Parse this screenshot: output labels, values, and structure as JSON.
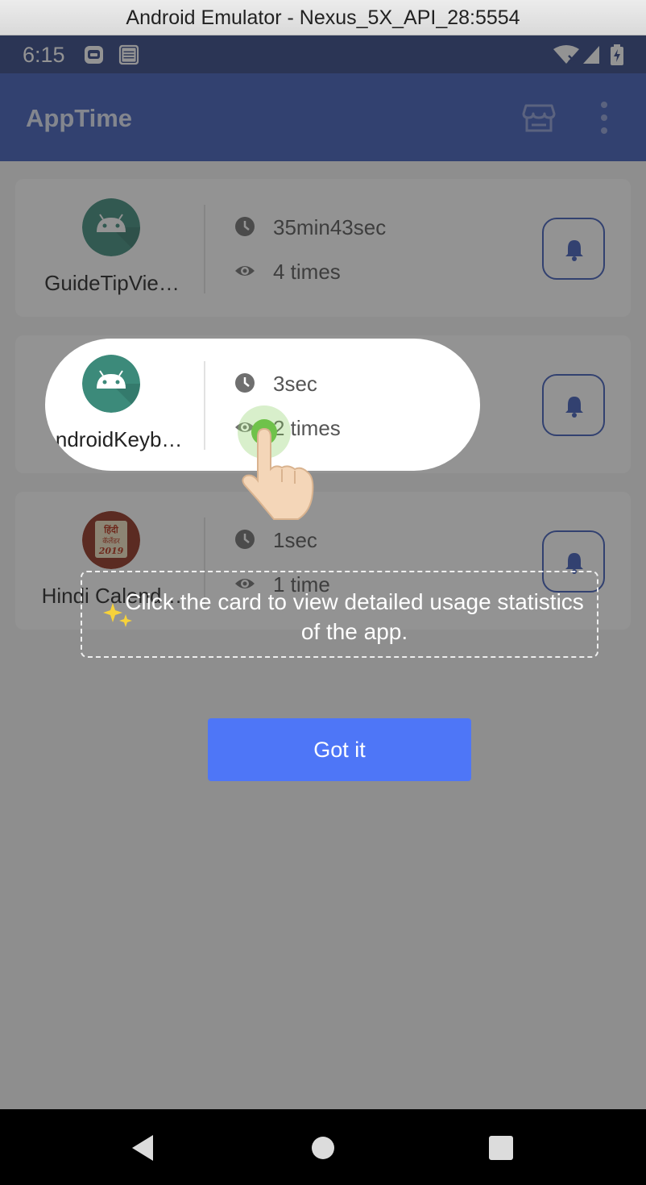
{
  "window": {
    "title": "Android Emulator - Nexus_5X_API_28:5554"
  },
  "status_bar": {
    "time": "6:15"
  },
  "app_bar": {
    "title": "AppTime",
    "store_icon": "store-icon",
    "more_icon": "more-vert-icon"
  },
  "apps": [
    {
      "name": "GuideTipVie…",
      "duration": "35min43sec",
      "opens": "4 times",
      "icon": "android-icon"
    },
    {
      "name": "AndroidKeyb…",
      "duration": "3sec",
      "opens": "2 times",
      "icon": "android-icon"
    },
    {
      "name": "Hindi Calend…",
      "duration": "1sec",
      "opens": "1 time",
      "icon": "calendar-2019-icon",
      "icon_text": [
        "हिंदी",
        "कॅलेंडर",
        "2019"
      ]
    }
  ],
  "guide": {
    "tip_text": "Click the card to view detailed usage statistics of the app.",
    "button_label": "Got it"
  },
  "colors": {
    "primary": "#3d5ab8",
    "status_bar": "#2f4283",
    "button": "#4e76f7",
    "android_icon_bg": "#3c8a7a",
    "touch_dot": "#6fc24a"
  }
}
